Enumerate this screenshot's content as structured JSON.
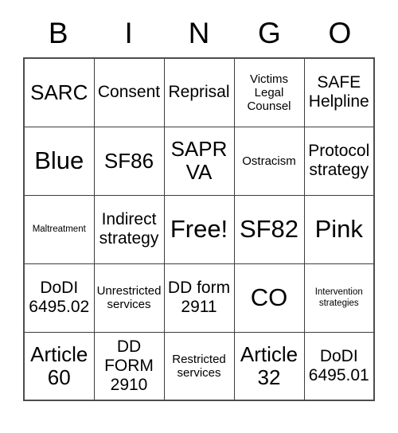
{
  "card": {
    "header_letters": [
      "B",
      "I",
      "N",
      "G",
      "O"
    ],
    "rows": [
      [
        {
          "text": "SARC",
          "size": "lg"
        },
        {
          "text": "Consent",
          "size": "md"
        },
        {
          "text": "Reprisal",
          "size": "md"
        },
        {
          "text": "Victims Legal Counsel",
          "size": "sm"
        },
        {
          "text": "SAFE Helpline",
          "size": "md"
        }
      ],
      [
        {
          "text": "Blue",
          "size": "xl"
        },
        {
          "text": "SF86",
          "size": "lg"
        },
        {
          "text": "SAPR VA",
          "size": "lg"
        },
        {
          "text": "Ostracism",
          "size": "sm"
        },
        {
          "text": "Protocol strategy",
          "size": "md"
        }
      ],
      [
        {
          "text": "Maltreatment",
          "size": "xs"
        },
        {
          "text": "Indirect strategy",
          "size": "md"
        },
        {
          "text": "Free!",
          "size": "xl"
        },
        {
          "text": "SF82",
          "size": "xl"
        },
        {
          "text": "Pink",
          "size": "xl"
        }
      ],
      [
        {
          "text": "DoDI 6495.02",
          "size": "md"
        },
        {
          "text": "Unrestricted services",
          "size": "sm"
        },
        {
          "text": "DD form 2911",
          "size": "md"
        },
        {
          "text": "CO",
          "size": "xl"
        },
        {
          "text": "Intervention strategies",
          "size": "xs"
        }
      ],
      [
        {
          "text": "Article 60",
          "size": "lg"
        },
        {
          "text": "DD FORM 2910",
          "size": "md"
        },
        {
          "text": "Restricted services",
          "size": "sm"
        },
        {
          "text": "Article 32",
          "size": "lg"
        },
        {
          "text": "DoDI 6495.01",
          "size": "md"
        }
      ]
    ]
  },
  "colors": {
    "background": "#ffffff",
    "text": "#000000",
    "outer_border": "#4d4d4d",
    "inner_border": "#3d3d3d"
  }
}
